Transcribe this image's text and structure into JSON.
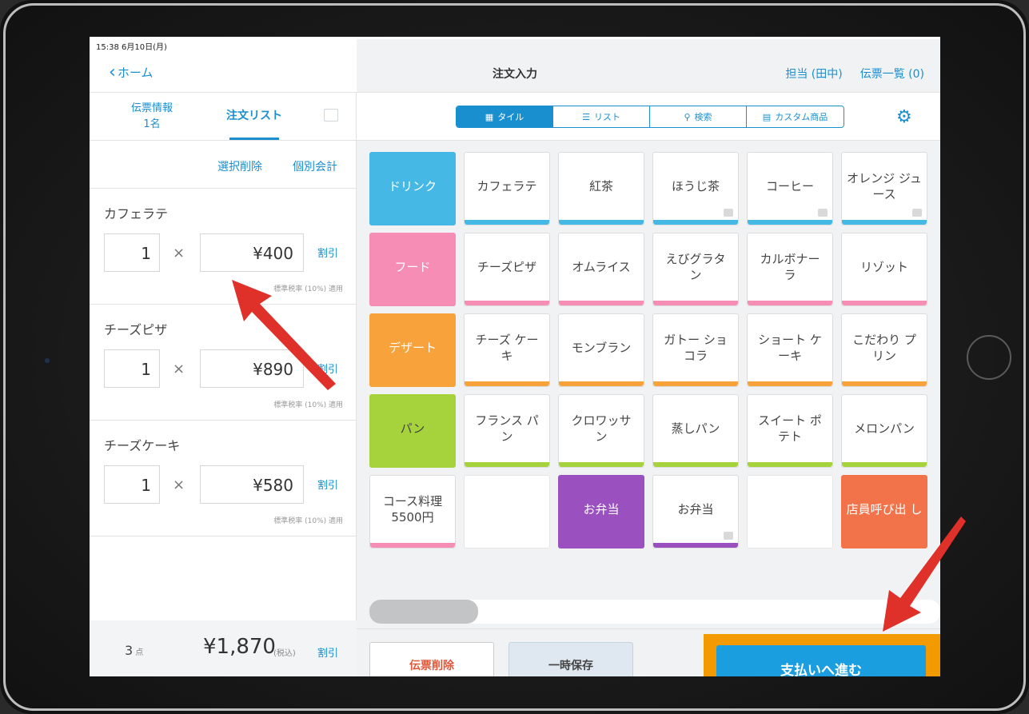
{
  "status_bar": {
    "time": "15:38  6月10日(月)",
    "dots": "•••"
  },
  "nav": {
    "back_label": "ホーム",
    "title": "注文入力",
    "staff": "担当 (田中)",
    "slip_list": "伝票一覧 (0)"
  },
  "left_tabs": {
    "slip_info_line1": "伝票情報",
    "slip_info_line2": "1名",
    "order_list": "注文リスト"
  },
  "left_actions": {
    "select_delete": "選択削除",
    "separate_bill": "個別会計"
  },
  "order_items": [
    {
      "name": "カフェラテ",
      "qty": "1",
      "price": "¥400",
      "discount": "割引",
      "tax_note": "標準税率 (10%) 適用"
    },
    {
      "name": "チーズピザ",
      "qty": "1",
      "price": "¥890",
      "discount": "割引",
      "tax_note": "標準税率 (10%) 適用"
    },
    {
      "name": "チーズケーキ",
      "qty": "1",
      "price": "¥580",
      "discount": "割引",
      "tax_note": "標準税率 (10%) 適用"
    }
  ],
  "times_symbol": "×",
  "summary": {
    "count": "3",
    "count_unit": "点",
    "total": "¥1,870",
    "tax_included": "(税込)",
    "discount": "割引"
  },
  "view_tabs": {
    "tile": "タイル",
    "list": "リスト",
    "search": "検索",
    "custom": "カスタム商品"
  },
  "categories": {
    "drink": {
      "label": "ドリンク",
      "color": "#46b8e6"
    },
    "food": {
      "label": "フード",
      "color": "#f58db4"
    },
    "dessert": {
      "label": "デザート",
      "color": "#f7a23a"
    },
    "bread": {
      "label": "パン",
      "color": "#a6d23c"
    }
  },
  "tiles": {
    "drink": [
      "カフェラテ",
      "紅茶",
      "ほうじ茶",
      "コーヒー",
      "オレンジ ジュース"
    ],
    "food": [
      "チーズピザ",
      "オムライス",
      "えびグラタ ン",
      "カルボナー ラ",
      "リゾット"
    ],
    "dessert": [
      "チーズ ケーキ",
      "モンブラン",
      "ガトー ショコラ",
      "ショート ケーキ",
      "こだわり プリン"
    ],
    "bread": [
      "フランス パン",
      "クロワッサ ン",
      "蒸しパン",
      "スイート ポテト",
      "メロンパン"
    ],
    "other": {
      "course": "コース料理 5500円",
      "bento_filled": "お弁当",
      "bento": "お弁当",
      "call_staff": "店員呼び出 し"
    }
  },
  "colors": {
    "accent": "#1a8fd0",
    "bento": "#9b50c0",
    "call_staff": "#f2734a",
    "highlight": "#f29a00"
  },
  "footer": {
    "delete_slip": "伝票削除",
    "hold": "一時保存",
    "proceed_payment": "支払いへ進む"
  }
}
